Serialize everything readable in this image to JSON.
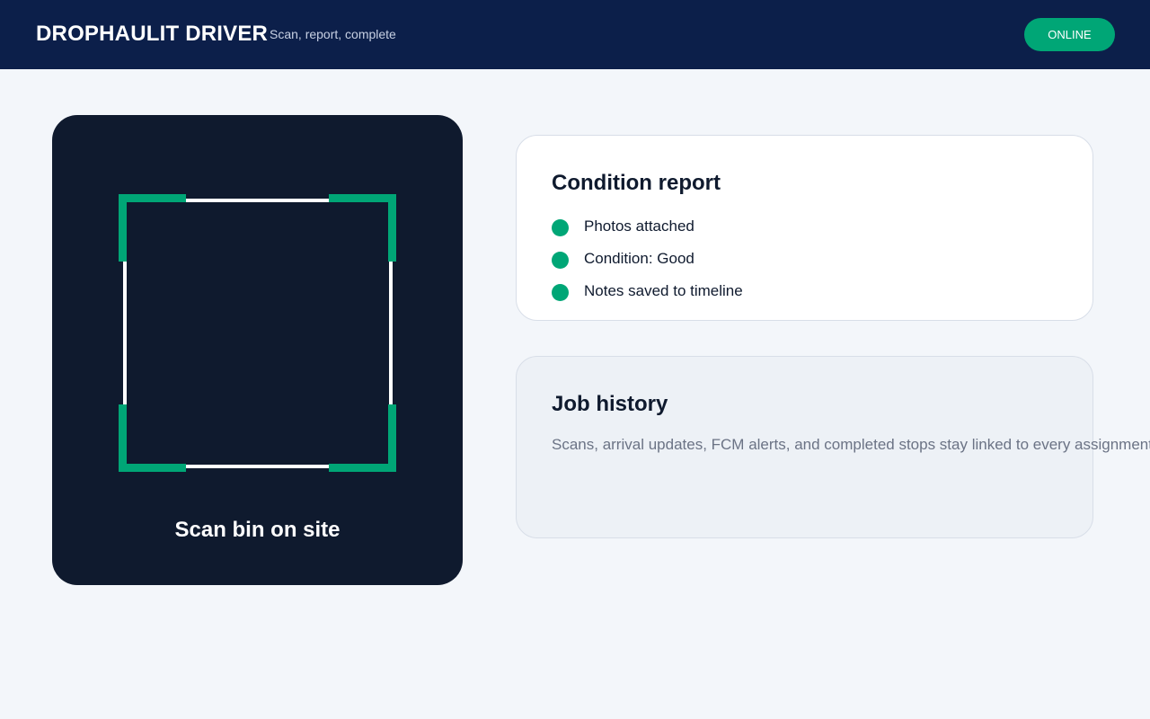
{
  "header": {
    "brand": "DROPHAULIT DRIVER",
    "tagline": "Scan, report, complete",
    "status": "ONLINE",
    "colors": {
      "background": "#0c1f4a",
      "status": "#00a676"
    }
  },
  "scanner": {
    "label": "Scan bin on site",
    "colors": {
      "panel": "#0f1a2e",
      "corner": "#00a676",
      "frame": "#ffffff"
    }
  },
  "condition_report": {
    "title": "Condition report",
    "items": [
      {
        "label": "Photos attached",
        "icon": "check-dot-icon"
      },
      {
        "label": "Condition: Good",
        "icon": "check-dot-icon"
      },
      {
        "label": "Notes saved to timeline",
        "icon": "check-dot-icon"
      }
    ]
  },
  "job_history": {
    "title": "Job history",
    "description": "Scans, arrival updates, FCM alerts, and completed stops stay linked to every assignment."
  }
}
